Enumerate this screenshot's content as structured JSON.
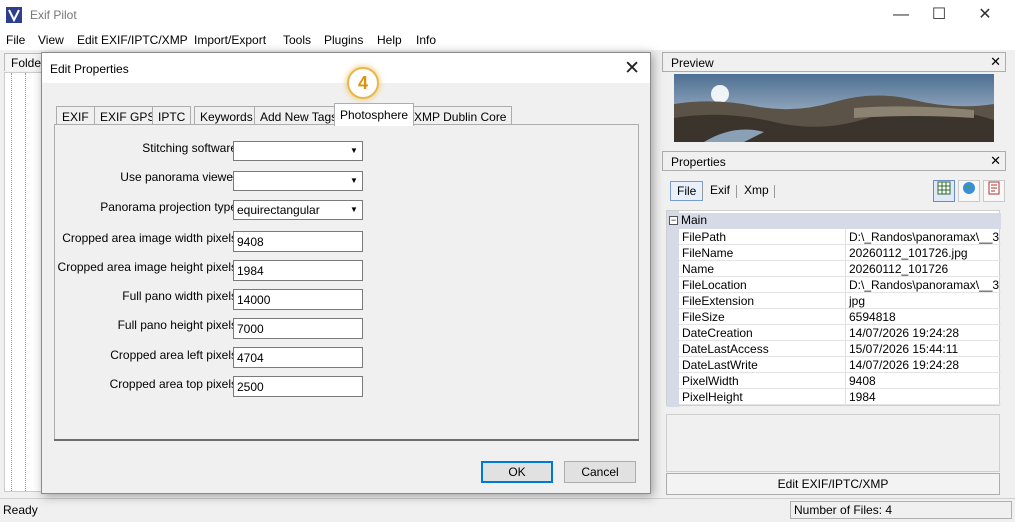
{
  "app": {
    "title": "Exif Pilot"
  },
  "window_controls": {
    "minimize": "—",
    "maximize": "☐",
    "close": "✕"
  },
  "menu": [
    "File",
    "View",
    "Edit EXIF/IPTC/XMP",
    "Import/Export",
    "Tools",
    "Plugins",
    "Help",
    "Info"
  ],
  "left_panel": {
    "tab_label": "Folders"
  },
  "status": {
    "left": "Ready",
    "right": "Number of Files: 4"
  },
  "preview": {
    "header": "Preview",
    "close": "✕"
  },
  "properties": {
    "header": "Properties",
    "close": "✕",
    "tabs": [
      "File",
      "Exif",
      "Xmp"
    ],
    "active_tab": "File",
    "section": "Main",
    "rows": [
      {
        "key": "FilePath",
        "value": "D:\\_Randos\\panoramax\\__3..."
      },
      {
        "key": "FileName",
        "value": "20260112_101726.jpg"
      },
      {
        "key": "Name",
        "value": "20260112_101726"
      },
      {
        "key": "FileLocation",
        "value": "D:\\_Randos\\panoramax\\__3..."
      },
      {
        "key": "FileExtension",
        "value": "jpg"
      },
      {
        "key": "FileSize",
        "value": "6594818"
      },
      {
        "key": "DateCreation",
        "value": "14/07/2026 19:24:28"
      },
      {
        "key": "DateLastAccess",
        "value": "15/07/2026 15:44:11"
      },
      {
        "key": "DateLastWrite",
        "value": "14/07/2026 19:24:28"
      },
      {
        "key": "PixelWidth",
        "value": "9408"
      },
      {
        "key": "PixelHeight",
        "value": "1984"
      }
    ],
    "edit_button": "Edit EXIF/IPTC/XMP",
    "toolbar_icons": [
      "grid-view-icon",
      "globe-icon",
      "report-icon"
    ]
  },
  "dialog": {
    "title": "Edit Properties",
    "close": "✕",
    "step_badge": "4",
    "tabs": [
      "EXIF",
      "EXIF GPS",
      "IPTC",
      "Keywords",
      "Add New Tags",
      "Photosphere",
      "XMP Dublin Core"
    ],
    "active_tab": "Photosphere",
    "fields": [
      {
        "label": "Stitching software",
        "kind": "combo",
        "value": ""
      },
      {
        "label": "Use panorama viewer",
        "kind": "combo",
        "value": ""
      },
      {
        "label": "Panorama projection type",
        "kind": "combo",
        "value": "equirectangular"
      },
      {
        "label": "Cropped area image width pixels",
        "kind": "text",
        "value": "9408"
      },
      {
        "label": "Cropped area image height pixels",
        "kind": "text",
        "value": "1984"
      },
      {
        "label": "Full pano width pixels",
        "kind": "text",
        "value": "14000"
      },
      {
        "label": "Full pano height pixels",
        "kind": "text",
        "value": "7000"
      },
      {
        "label": "Cropped area left pixels",
        "kind": "text",
        "value": "4704"
      },
      {
        "label": "Cropped area top pixels",
        "kind": "text",
        "value": "2500"
      }
    ],
    "ok": "OK",
    "cancel": "Cancel"
  },
  "colors": {
    "accent_blue": "#0078d7",
    "badge_orange": "#d79412",
    "grid_gutter": "#d6dae6"
  }
}
